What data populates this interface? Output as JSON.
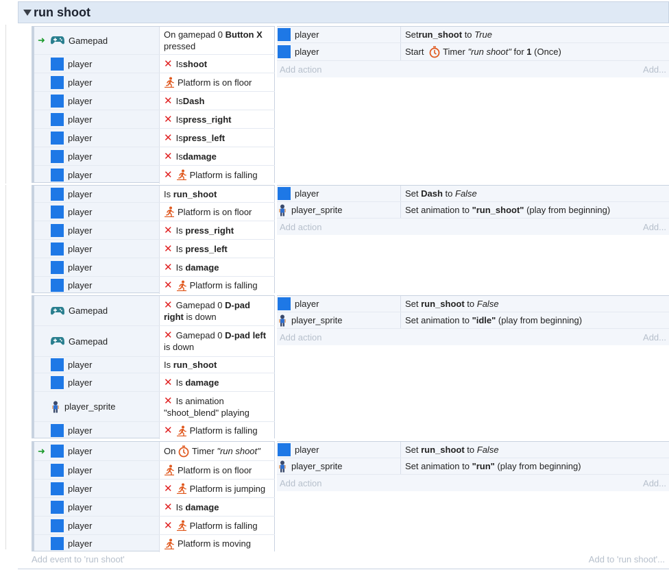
{
  "group": {
    "title": "run shoot"
  },
  "labels": {
    "add_action": "Add action",
    "add_right": "Add...",
    "add_event": "Add event to 'run shoot'",
    "add_to": "Add to 'run shoot'..."
  },
  "e1": {
    "c1_obj": "Gamepad",
    "c1_a": "On gamepad 0 ",
    "c1_b": "Button X",
    "c1_c": "pressed",
    "c2_obj": "player",
    "c2_a": "Is ",
    "c2_b": "shoot",
    "c3_obj": "player",
    "c3_a": "Platform is on floor",
    "c4_obj": "player",
    "c4_a": "Is ",
    "c4_b": "Dash",
    "c5_obj": "player",
    "c5_a": "Is ",
    "c5_b": "press_right",
    "c6_obj": "player",
    "c6_a": "Is ",
    "c6_b": "press_left",
    "c7_obj": "player",
    "c7_a": "Is ",
    "c7_b": "damage",
    "c8_obj": "player",
    "c8_a": "Platform is falling",
    "a1_obj": "player",
    "a1_a": "Set ",
    "a1_b": "run_shoot",
    "a1_c": " to ",
    "a1_d": "True",
    "a2_obj": "player",
    "a2_a": "Start ",
    "a2_b": "Timer ",
    "a2_c": "\"run shoot\"",
    "a2_d": " for ",
    "a2_e": "1",
    "a2_f": " (Once)"
  },
  "e2": {
    "c1_obj": "player",
    "c1_a": "Is ",
    "c1_b": "run_shoot",
    "c2_obj": "player",
    "c2_a": "Platform is on floor",
    "c3_obj": "player",
    "c3_a": "Is ",
    "c3_b": "press_right",
    "c4_obj": "player",
    "c4_a": "Is ",
    "c4_b": "press_left",
    "c5_obj": "player",
    "c5_a": "Is ",
    "c5_b": "damage",
    "c6_obj": "player",
    "c6_a": "Platform is falling",
    "a1_obj": "player",
    "a1_a": "Set ",
    "a1_b": "Dash",
    "a1_c": " to ",
    "a1_d": "False",
    "a2_obj": "player_sprite",
    "a2_a": "Set animation to ",
    "a2_b": "\"run_shoot\"",
    "a2_c": " (play from beginning)"
  },
  "e3": {
    "c1_obj": "Gamepad",
    "c1_a": "Gamepad 0 ",
    "c1_b": "D-pad",
    "c1_c": "right",
    "c1_d": " is down",
    "c2_obj": "Gamepad",
    "c2_a": "Gamepad 0 ",
    "c2_b": "D-pad left",
    "c2_c": "is down",
    "c3_obj": "player",
    "c3_a": "Is ",
    "c3_b": "run_shoot",
    "c4_obj": "player",
    "c4_a": "Is ",
    "c4_b": "damage",
    "c5_obj": "player_sprite",
    "c5_a": "Is animation",
    "c5_b": "\"shoot_blend\" playing",
    "c6_obj": "player",
    "c6_a": "Platform is falling",
    "a1_obj": "player",
    "a1_a": "Set ",
    "a1_b": "run_shoot",
    "a1_c": " to ",
    "a1_d": "False",
    "a2_obj": "player_sprite",
    "a2_a": "Set animation to ",
    "a2_b": "\"idle\"",
    "a2_c": " (play from beginning)"
  },
  "e4": {
    "c1_obj": "player",
    "c1_a": "On ",
    "c1_b": "Timer ",
    "c1_c": "\"run shoot\"",
    "c2_obj": "player",
    "c2_a": "Platform is on floor",
    "c3_obj": "player",
    "c3_a": "Platform is jumping",
    "c4_obj": "player",
    "c4_a": "Is ",
    "c4_b": "damage",
    "c5_obj": "player",
    "c5_a": "Platform is falling",
    "c6_obj": "player",
    "c6_a": "Platform is moving",
    "a1_obj": "player",
    "a1_a": "Set ",
    "a1_b": "run_shoot",
    "a1_c": " to ",
    "a1_d": "False",
    "a2_obj": "player_sprite",
    "a2_a": "Set animation to ",
    "a2_b": "\"run\"",
    "a2_c": " (play from beginning)"
  }
}
